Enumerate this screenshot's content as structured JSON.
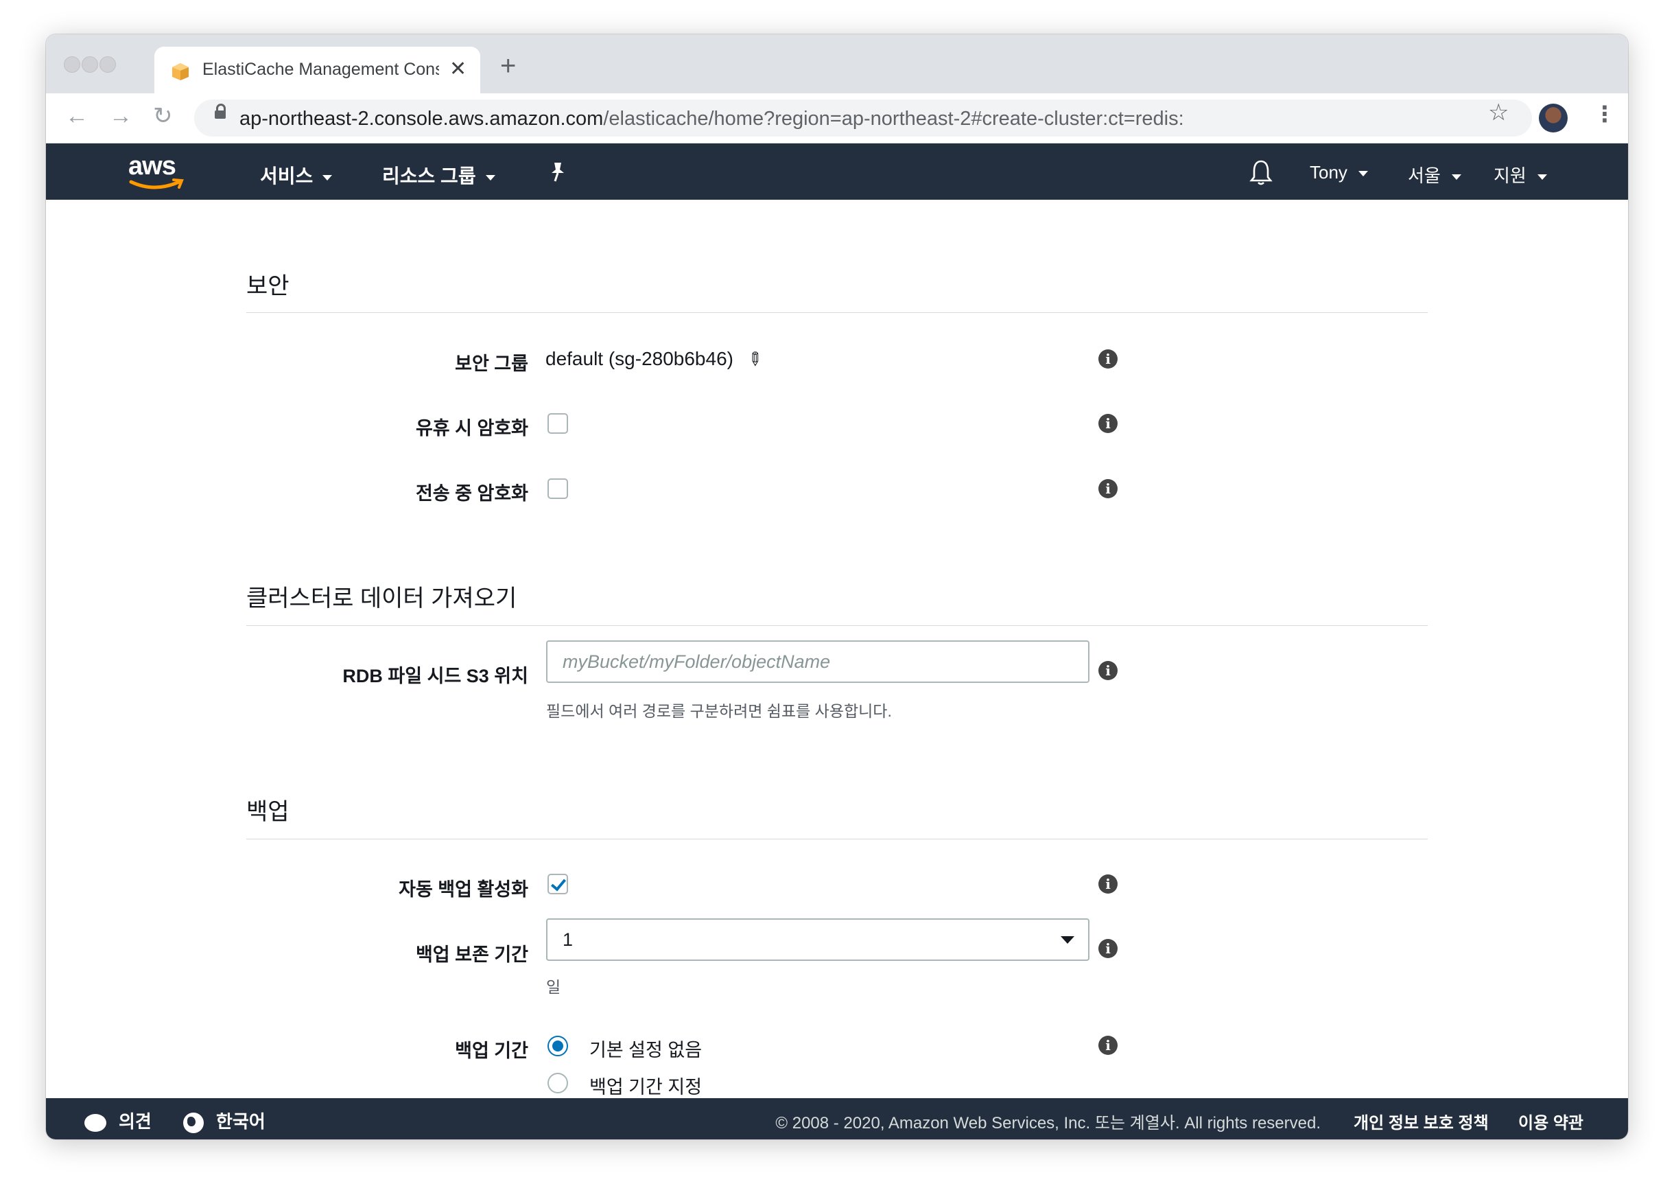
{
  "browser": {
    "tab_title": "ElastiCache Management Console",
    "url_host": "ap-northeast-2.console.aws.amazon.com",
    "url_path": "/elasticache/home?region=ap-northeast-2#create-cluster:ct=redis:",
    "new_tab": "+",
    "close": "✕"
  },
  "aws_header": {
    "logo": "aws",
    "services": "서비스",
    "resource_groups": "리소스 그룹",
    "pin": "📌",
    "bell": "🔔",
    "user": "Tony",
    "region": "서울",
    "support": "지원"
  },
  "security": {
    "title": "보안",
    "security_group_label": "보안 그룹",
    "security_group_value": "default (sg-280b6b46)",
    "encryption_at_rest_label": "유휴 시 암호화",
    "encryption_at_rest_checked": false,
    "encryption_in_transit_label": "전송 중 암호화",
    "encryption_in_transit_checked": false
  },
  "import": {
    "title": "클러스터로 데이터 가져오기",
    "rdb_label": "RDB 파일 시드 S3 위치",
    "rdb_placeholder": "myBucket/myFolder/objectName",
    "rdb_hint": "필드에서 여러 경로를 구분하려면 쉼표를 사용합니다."
  },
  "backup": {
    "title": "백업",
    "auto_backup_label": "자동 백업 활성화",
    "auto_backup_checked": true,
    "retention_label": "백업 보존 기간",
    "retention_value": "1",
    "retention_unit": "일",
    "window_label": "백업 기간",
    "window_options": [
      "기본 설정 없음",
      "백업 기간 지정"
    ],
    "window_selected": 0
  },
  "footer": {
    "feedback": "의견",
    "language": "한국어",
    "copyright": "© 2008 - 2020, Amazon Web Services, Inc. 또는 계열사. All rights reserved.",
    "privacy": "개인 정보 보호 정책",
    "terms": "이용 약관"
  },
  "colors": {
    "aws_nav_bg": "#232f3e",
    "accent_blue": "#0073bb",
    "aws_orange": "#ff9900"
  },
  "icons": [
    "lock-icon",
    "star-icon",
    "bell-icon",
    "pin-icon",
    "info-icon",
    "pencil-icon",
    "dropdown-caret-icon",
    "chat-bubble-icon",
    "globe-icon"
  ]
}
